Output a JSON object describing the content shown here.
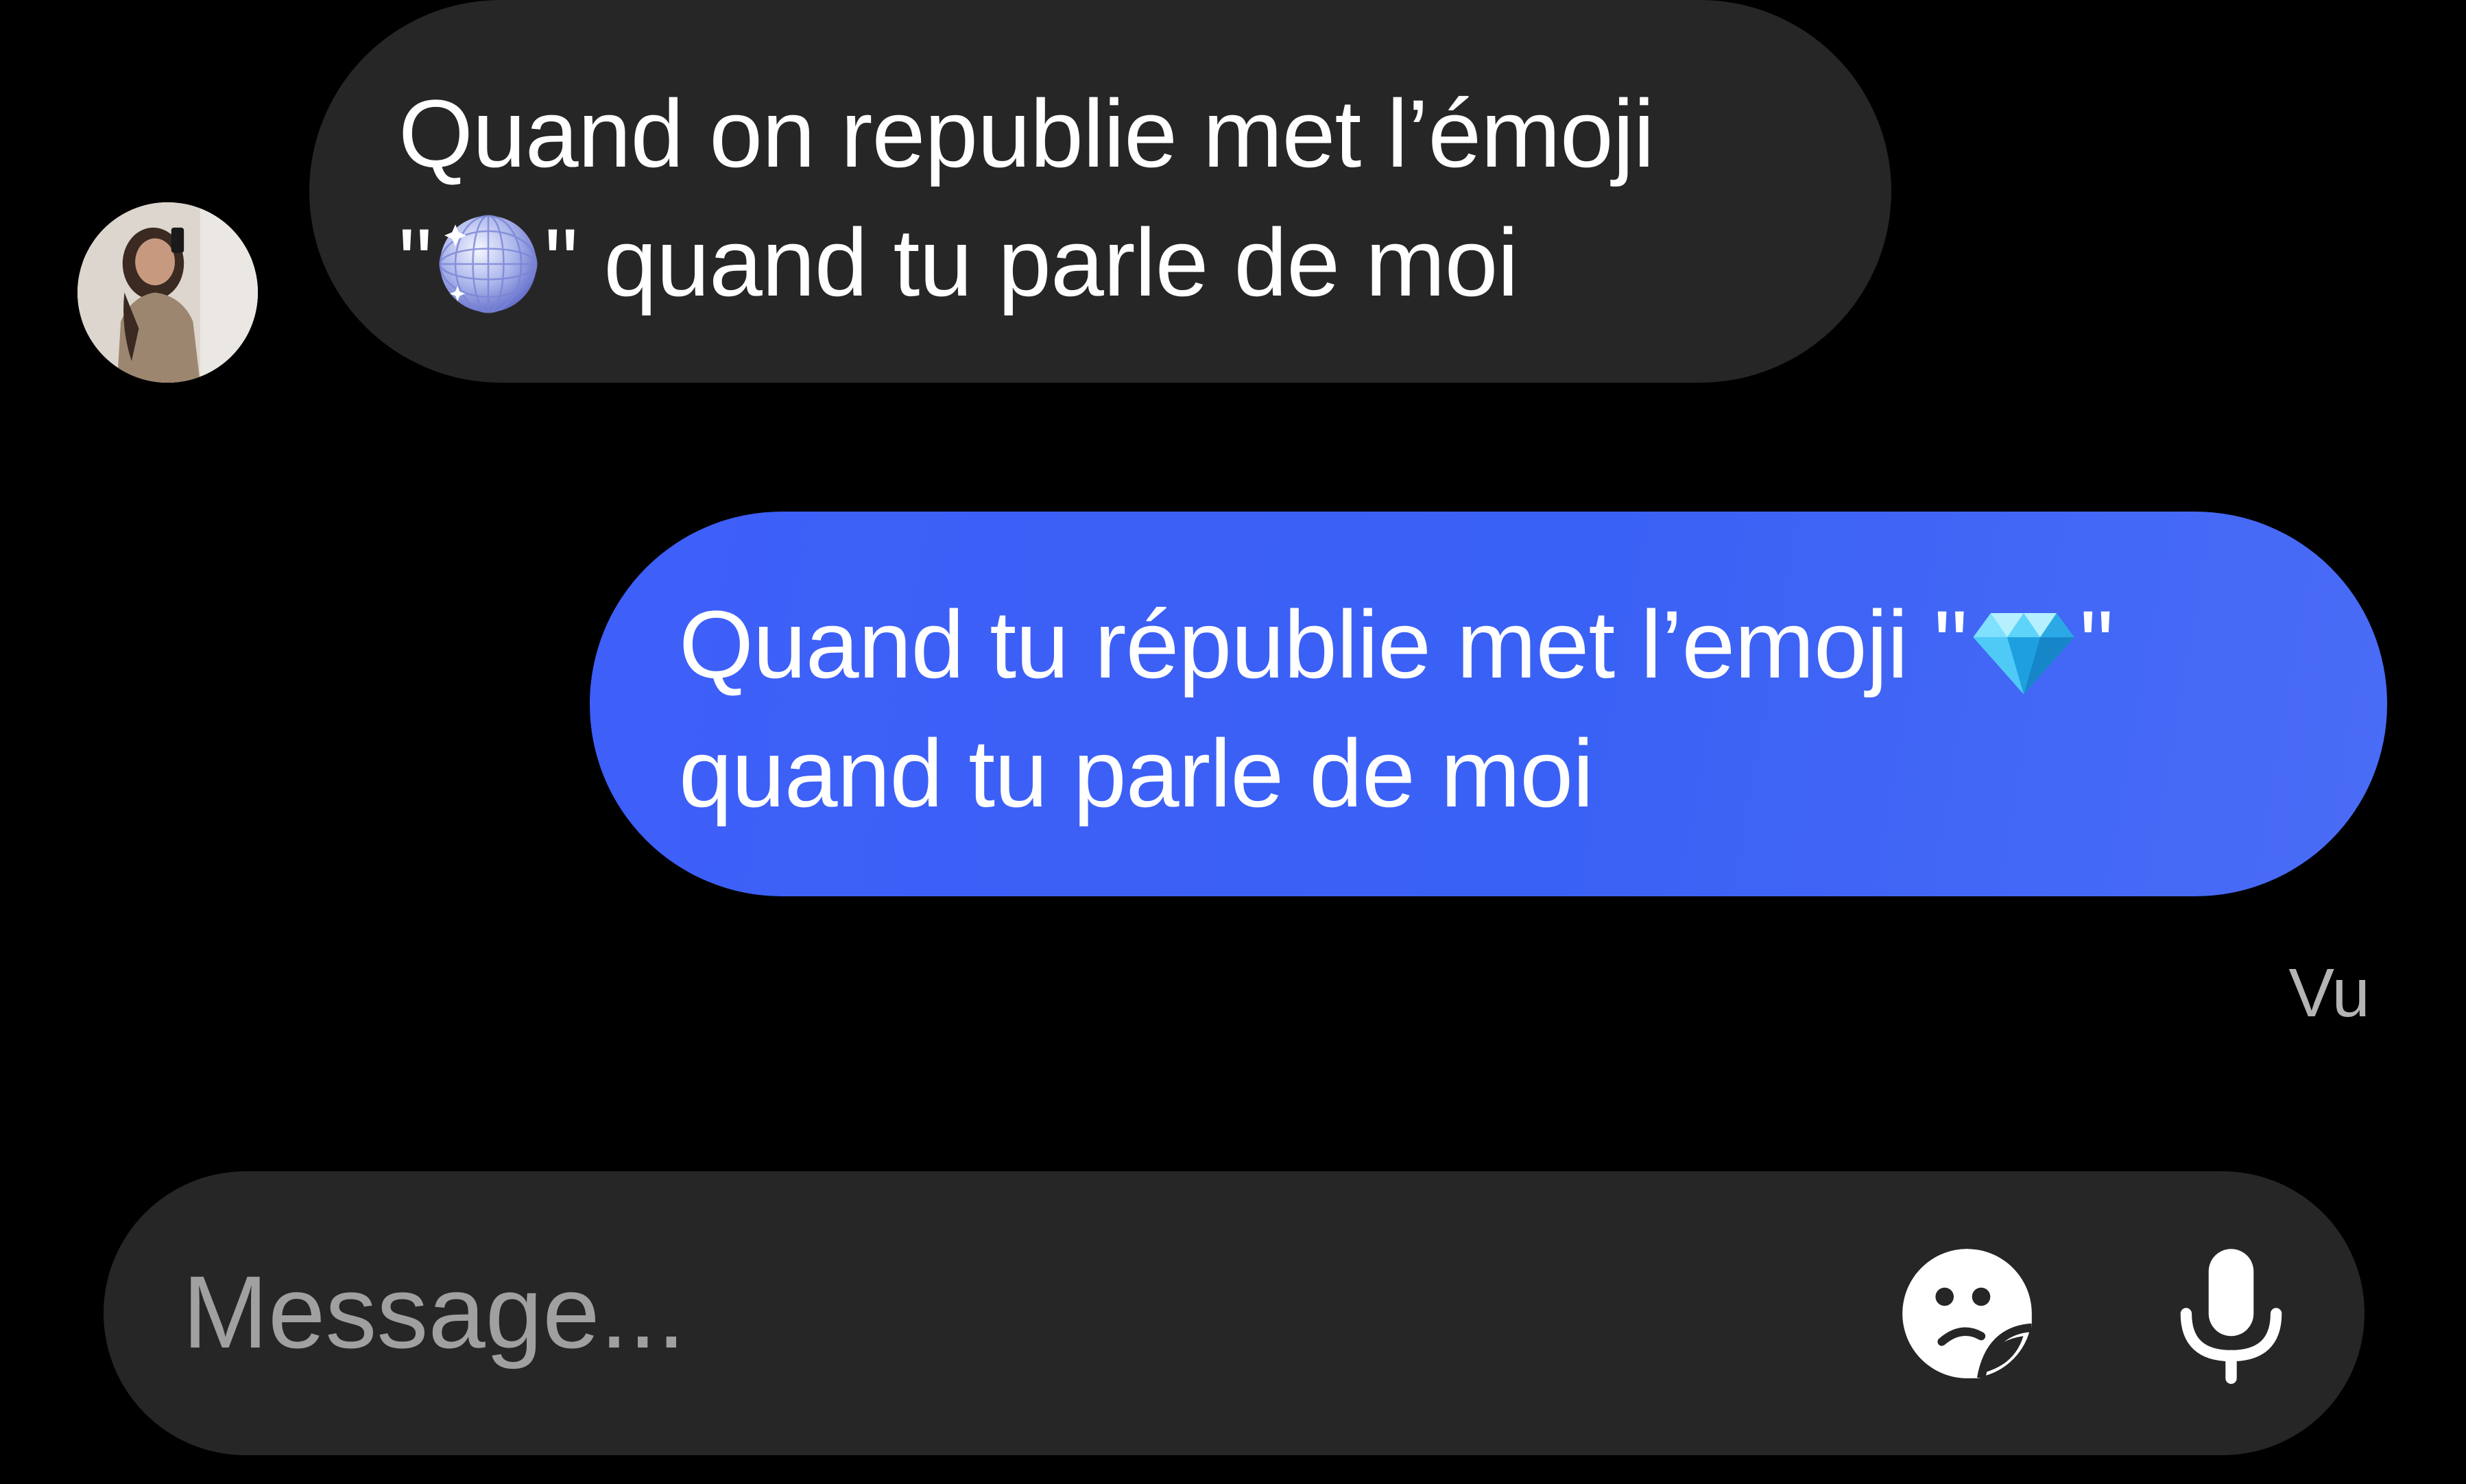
{
  "conversation": {
    "incoming": {
      "line1": "Quand on republie met l’émoji",
      "line2_before": "\"",
      "emoji": "disco-ball-emoji",
      "line2_after": "\" quand tu parle de moi"
    },
    "outgoing": {
      "line1_before": "Quand tu républie met l’emoji \"",
      "emoji": "gem-emoji",
      "line1_after": "\"",
      "line2": "quand tu parle de moi"
    },
    "seen_label": "Vu"
  },
  "composer": {
    "placeholder": "Message...",
    "icons": [
      "sticker-icon",
      "microphone-icon"
    ]
  },
  "colors": {
    "background": "#000000",
    "incoming_bubble": "#262626",
    "outgoing_bubble": "#3e5ff8",
    "seen_text": "#b4b4b4",
    "composer": "#262626"
  }
}
